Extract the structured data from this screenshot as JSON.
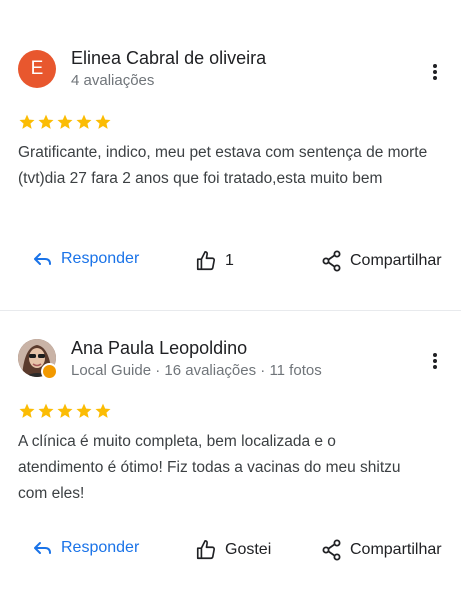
{
  "reviews": [
    {
      "avatar_letter": "E",
      "avatar_color": "#e8572e",
      "name": "Elinea Cabral de oliveira",
      "meta": "4 avaliações",
      "rating": 5,
      "text": "Gratificante, indico, meu pet estava com sentença de morte (tvt)dia 27 fara 2 anos que foi tratado,esta muito bem",
      "reply_label": "Responder",
      "like_label": "1",
      "share_label": "Compartilhar"
    },
    {
      "avatar_type": "photo",
      "name": "Ana Paula Leopoldino",
      "meta": "Local Guide · 16 avaliações · 11 fotos",
      "rating": 5,
      "text": "A clínica é muito completa, bem localizada e o atendimento é ótimo! Fiz todas a vacinas do meu shitzu com eles!",
      "reply_label": "Responder",
      "like_label": "Gostei",
      "share_label": "Compartilhar"
    }
  ],
  "colors": {
    "star": "#fbbc04",
    "link": "#1a73e8",
    "secondary_text": "#70757a"
  },
  "icons": [
    "more-vert-icon",
    "star-icon",
    "reply-icon",
    "thumb-up-icon",
    "share-icon",
    "local-guide-badge-icon"
  ]
}
